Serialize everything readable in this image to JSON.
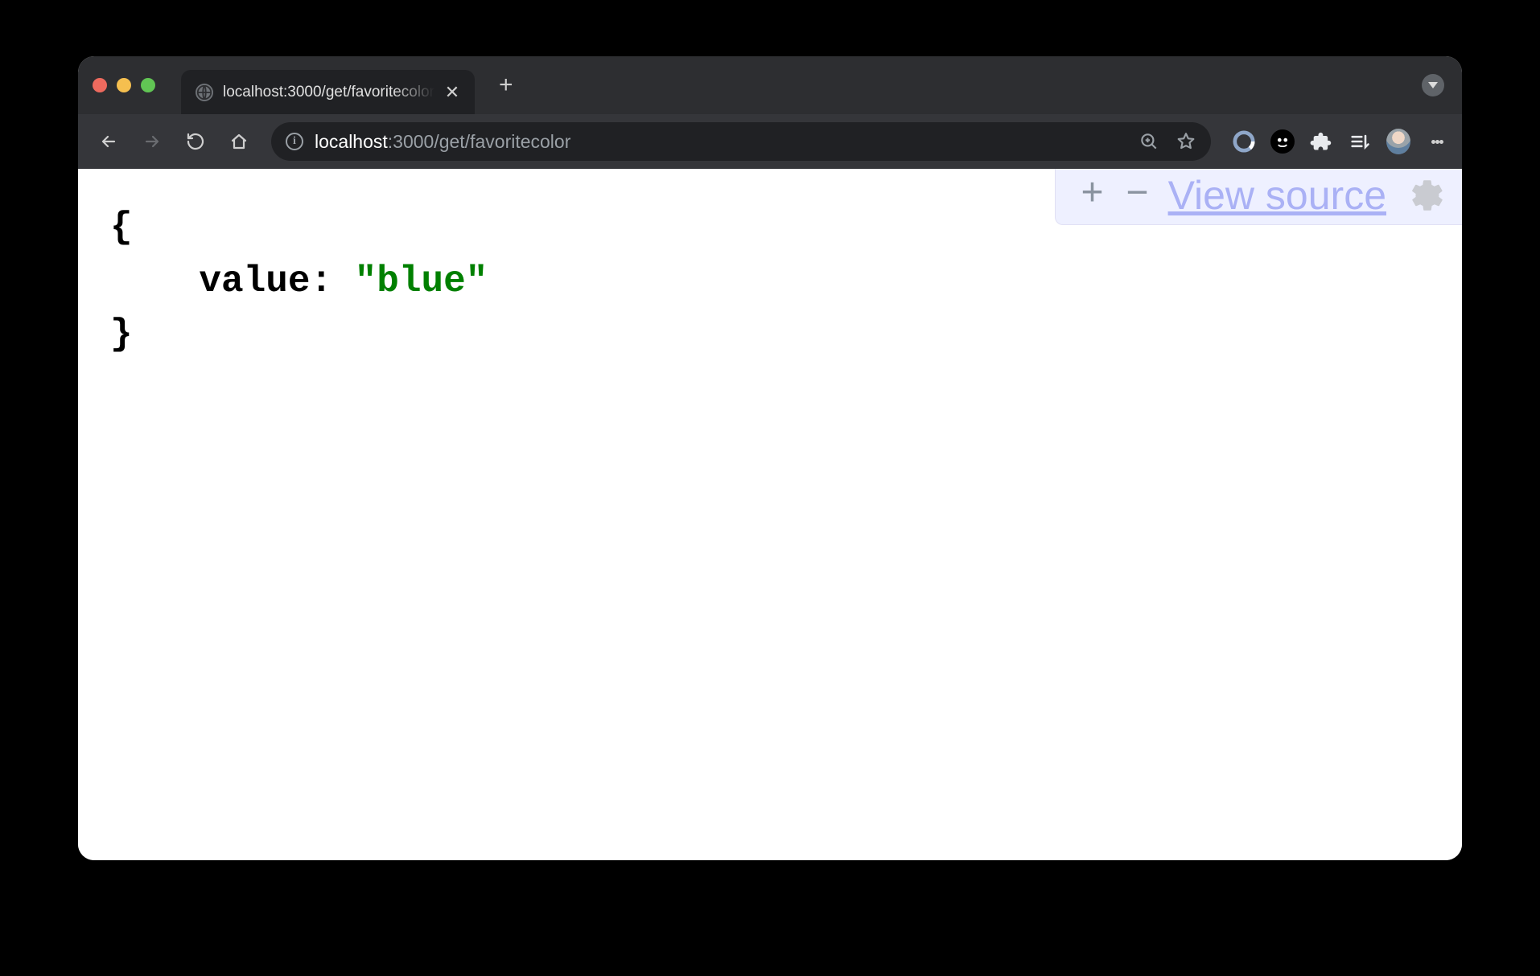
{
  "tab": {
    "title": "localhost:3000/get/favoritecolor"
  },
  "addressbar": {
    "host": "localhost",
    "rest": ":3000/get/favoritecolor"
  },
  "json_toolbar": {
    "plus": "+",
    "minus": "−",
    "view_source_label": "View source"
  },
  "json_body": {
    "open_brace": "{",
    "key_line_prefix": "    value: ",
    "string_value": "\"blue\"",
    "close_brace": "}"
  }
}
